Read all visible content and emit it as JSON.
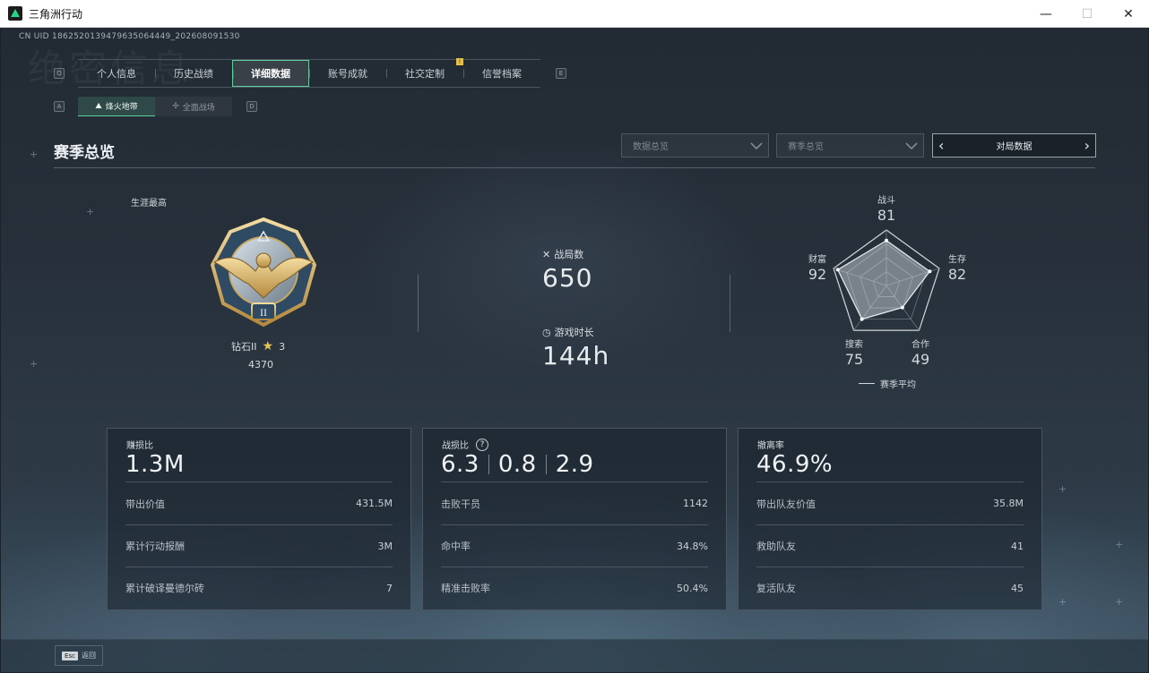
{
  "window": {
    "title": "三角洲行动",
    "controls": [
      "—",
      "☐",
      "✕"
    ]
  },
  "uid": "CN UID 1862520139479635064449_202608091530",
  "ghost_title": "绝密信息",
  "keycaps": {
    "tab_left": "Q",
    "tab_right": "E",
    "sub_left": "A",
    "sub_right": "D"
  },
  "tabs": [
    {
      "label": "个人信息"
    },
    {
      "label": "历史战绩"
    },
    {
      "label": "详细数据"
    },
    {
      "label": "账号成就"
    },
    {
      "label": "社交定制",
      "badge": "!"
    },
    {
      "label": "信誉档案"
    }
  ],
  "subtabs": [
    {
      "label": "烽火地带",
      "icon": "map-icon"
    },
    {
      "label": "全面战场",
      "icon": "battlefield-icon"
    }
  ],
  "section": {
    "title": "赛季总览"
  },
  "filters": {
    "data_overview": "数据总览",
    "season_overview": "赛季总览",
    "pager_label": "对局数据"
  },
  "rank": {
    "career_label": "生涯最高",
    "tier": "钻石II",
    "stars": "3",
    "score": "4370",
    "badge_numeral": "II"
  },
  "stats": {
    "matches_label": "战局数",
    "matches_value": "650",
    "playtime_label": "游戏时长",
    "playtime_value": "144h"
  },
  "radar": {
    "axes": [
      {
        "label": "战斗",
        "value": "81"
      },
      {
        "label": "生存",
        "value": "82"
      },
      {
        "label": "合作",
        "value": "49"
      },
      {
        "label": "搜索",
        "value": "75"
      },
      {
        "label": "财富",
        "value": "92"
      }
    ],
    "legend": "赛季平均"
  },
  "cards": [
    {
      "label": "赚损比",
      "big": [
        "1.3M"
      ],
      "rows": [
        {
          "k": "带出价值",
          "v": "431.5M"
        },
        {
          "k": "累计行动报酬",
          "v": "3M"
        },
        {
          "k": "累计破译曼德尔砖",
          "v": "7"
        }
      ]
    },
    {
      "label": "战损比",
      "big": [
        "6.3",
        "0.8",
        "2.9"
      ],
      "help": "?",
      "rows": [
        {
          "k": "击败干员",
          "v": "1142"
        },
        {
          "k": "命中率",
          "v": "34.8%"
        },
        {
          "k": "精准击败率",
          "v": "50.4%"
        }
      ]
    },
    {
      "label": "撤离率",
      "big": [
        "46.9%"
      ],
      "rows": [
        {
          "k": "带出队友价值",
          "v": "35.8M"
        },
        {
          "k": "救助队友",
          "v": "41"
        },
        {
          "k": "复活队友",
          "v": "45"
        }
      ]
    }
  ],
  "bottom": {
    "esc_key": "Esc",
    "esc_label": "返回"
  },
  "colors": {
    "accent": "#5fcf9c",
    "star": "#e7c451",
    "badge": "#e6c14a"
  }
}
